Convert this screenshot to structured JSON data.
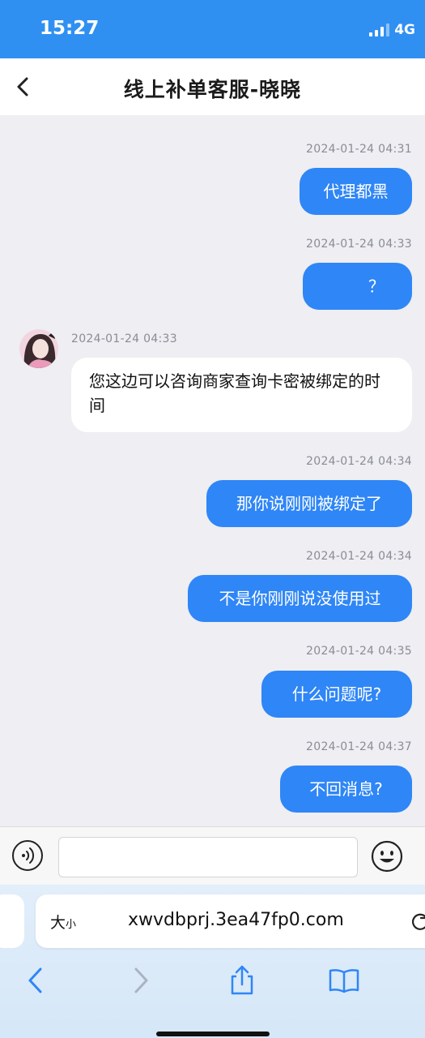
{
  "status": {
    "time": "15:27",
    "network": "4G"
  },
  "nav": {
    "title": "线上补单客服-晓晓",
    "back_icon": "chevron-left-icon"
  },
  "messages": [
    {
      "time": "2024-01-24 04:31",
      "text": "代理都黑",
      "side": "out"
    },
    {
      "time": "2024-01-24 04:33",
      "text": "？",
      "side": "out"
    },
    {
      "time": "2024-01-24 04:33",
      "text": "您这边可以咨询商家查询卡密被绑定的时间",
      "side": "in"
    },
    {
      "time": "2024-01-24 04:34",
      "text": "那你说刚刚被绑定了",
      "side": "out"
    },
    {
      "time": "2024-01-24 04:34",
      "text": "不是你刚刚说没使用过",
      "side": "out"
    },
    {
      "time": "2024-01-24 04:35",
      "text": "什么问题呢?",
      "side": "out"
    },
    {
      "time": "2024-01-24 04:37",
      "text": "不回消息?",
      "side": "out"
    }
  ],
  "input": {
    "value": "",
    "placeholder": ""
  },
  "browser": {
    "text_size_big": "大",
    "text_size_small": "小",
    "url": "xwvdbprj.3ea47fp0.com"
  },
  "colors": {
    "accent": "#2f90f2",
    "bubble_out": "#2f86f6",
    "chat_bg": "#eeeef3"
  }
}
